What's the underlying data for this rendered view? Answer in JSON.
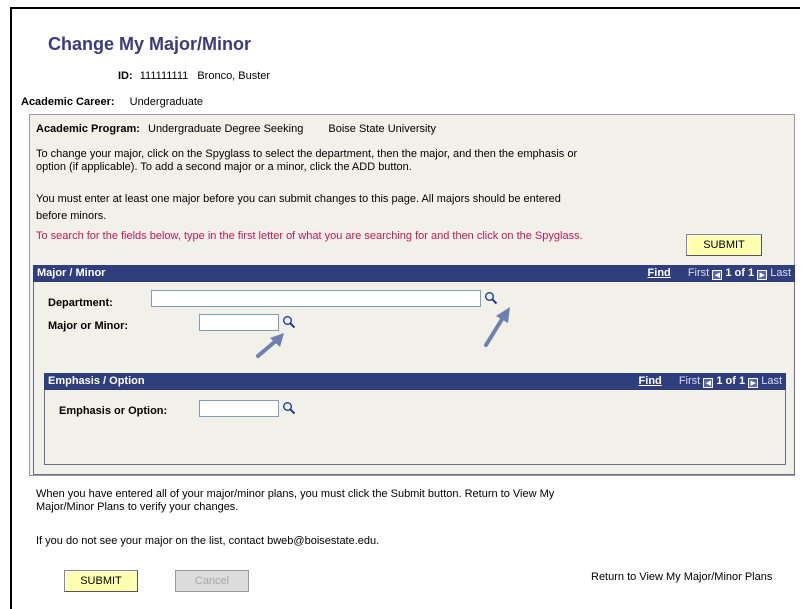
{
  "page": {
    "title": "Change My Major/Minor"
  },
  "student": {
    "id_label": "ID:",
    "id_value": "111111111",
    "name": "Bronco, Buster"
  },
  "career": {
    "label": "Academic Career:",
    "value": "Undergraduate"
  },
  "program": {
    "label": "Academic Program:",
    "value": "Undergraduate Degree Seeking",
    "institution": "Boise State University"
  },
  "instructions": {
    "line1": "To change your major, click on the Spyglass to select the department, then the major, and then the emphasis or",
    "line2": "option (if applicable). To add a second major or a minor, click the ADD button.",
    "line3": "You must enter at least one major before you can submit changes to this page. All majors should be entered",
    "line4": "before minors.",
    "line5": "To search for the fields below, type in the first letter of what you are searching for and then click on the Spyglass."
  },
  "buttons": {
    "submit": "SUBMIT",
    "cancel": "Cancel"
  },
  "major_section": {
    "title": "Major / Minor",
    "find": "Find",
    "first": "First",
    "count": "1 of 1",
    "last": "Last",
    "department_label": "Department:",
    "department_value": "",
    "major_label": "Major or Minor:",
    "major_value": ""
  },
  "emphasis_section": {
    "title": "Emphasis / Option",
    "find": "Find",
    "first": "First",
    "count": "1 of 1",
    "last": "Last",
    "emphasis_label": "Emphasis or Option:",
    "emphasis_value": ""
  },
  "footer": {
    "line1": "When you have entered all of your major/minor plans, you must click the Submit button. Return to View My",
    "line2": "Major/Minor Plans to verify your changes.",
    "line3": "If you do not see your major on the list, contact bweb@boisestate.edu."
  },
  "links": {
    "return": "Return to View My Major/Minor Plans"
  },
  "colors": {
    "header_bar": "#2f3f7e",
    "title": "#3a3a7c",
    "instruction_red": "#c2185b",
    "submit_bg": "#ffffb0",
    "panel_bg": "#f1f1e9"
  },
  "icons": {
    "spyglass": "spyglass-icon",
    "annotation": "arrow-annotation-icon"
  }
}
